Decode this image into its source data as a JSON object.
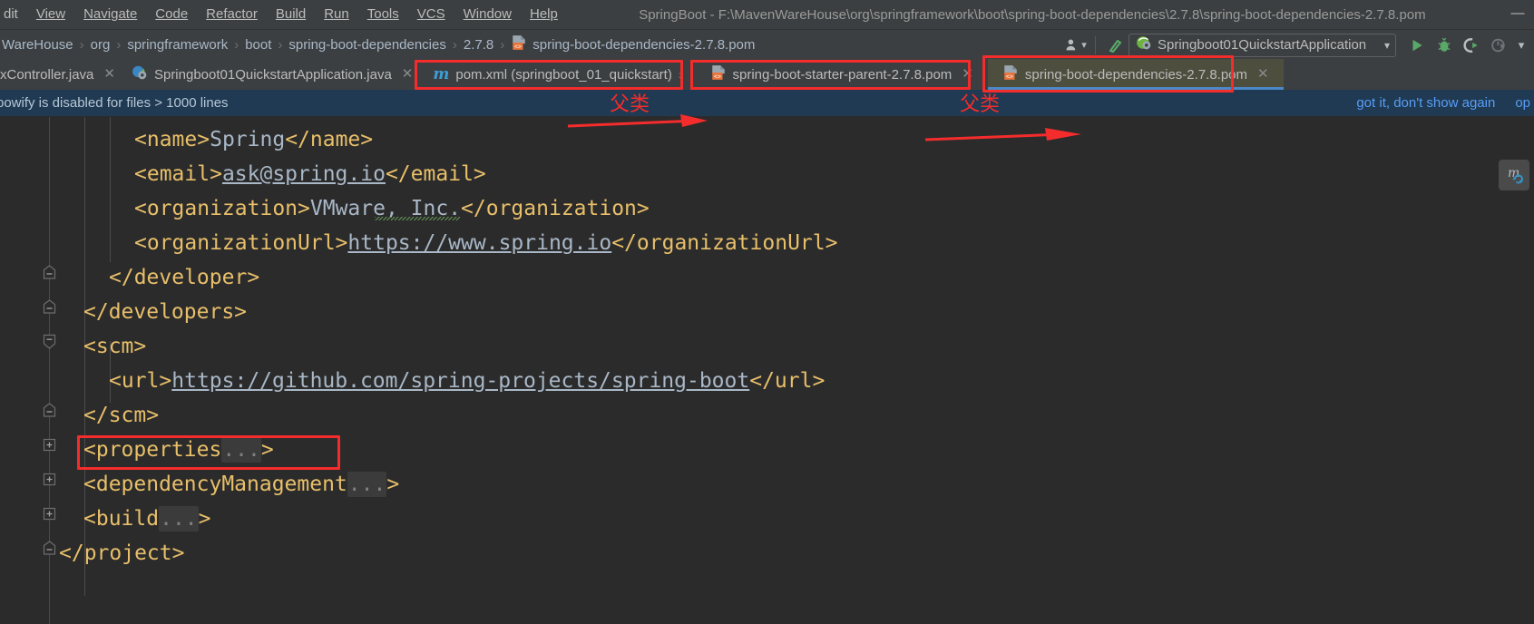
{
  "window": {
    "title": "SpringBoot - F:\\MavenWareHouse\\org\\springframework\\boot\\spring-boot-dependencies\\2.7.8\\spring-boot-dependencies-2.7.8.pom",
    "minimize_glyph": "—"
  },
  "menu": {
    "items": [
      {
        "label": "dit",
        "mnemonic": ""
      },
      {
        "label": "View",
        "mnemonic": "V"
      },
      {
        "label": "Navigate",
        "mnemonic": "N"
      },
      {
        "label": "Code",
        "mnemonic": "C"
      },
      {
        "label": "Refactor",
        "mnemonic": "R"
      },
      {
        "label": "Build",
        "mnemonic": "B"
      },
      {
        "label": "Run",
        "mnemonic": "u"
      },
      {
        "label": "Tools",
        "mnemonic": "T"
      },
      {
        "label": "VCS",
        "mnemonic": "S"
      },
      {
        "label": "Window",
        "mnemonic": "W"
      },
      {
        "label": "Help",
        "mnemonic": "H"
      }
    ]
  },
  "breadcrumb": {
    "items": [
      {
        "label": "WareHouse",
        "icon": ""
      },
      {
        "label": "org",
        "icon": ""
      },
      {
        "label": "springframework",
        "icon": ""
      },
      {
        "label": "boot",
        "icon": ""
      },
      {
        "label": "spring-boot-dependencies",
        "icon": ""
      },
      {
        "label": "2.7.8",
        "icon": ""
      },
      {
        "label": "spring-boot-dependencies-2.7.8.pom",
        "icon": "maven-pom-icon"
      }
    ],
    "separator": "›"
  },
  "toolbar": {
    "user_icon": "user-dropdown-icon",
    "build_icon": "build-hammer-icon",
    "run_config": {
      "icon": "spring-boot-run-icon",
      "label": "Springboot01QuickstartApplication",
      "chevron": "▾"
    },
    "run_icon": "run-play-icon",
    "debug_icon": "debug-bug-icon",
    "run_coverage_icon": "run-with-coverage-icon",
    "profiler_icon": "profiler-icon",
    "more_chevron": "▾"
  },
  "tabs": [
    {
      "label": "xController.java",
      "icon": "java-class-icon",
      "selected": false,
      "closable": true,
      "highlighted": false
    },
    {
      "label": "Springboot01QuickstartApplication.java",
      "icon": "spring-boot-class-icon",
      "selected": false,
      "closable": true,
      "highlighted": false
    },
    {
      "label": "pom.xml (springboot_01_quickstart)",
      "icon": "maven-m-icon",
      "selected": false,
      "closable": true,
      "highlighted": true
    },
    {
      "label": "spring-boot-starter-parent-2.7.8.pom",
      "icon": "maven-pom-icon",
      "selected": false,
      "closable": true,
      "highlighted": true
    },
    {
      "label": "spring-boot-dependencies-2.7.8.pom",
      "icon": "maven-pom-icon",
      "selected": true,
      "closable": true,
      "highlighted": true
    }
  ],
  "notification": {
    "message": "bowify is disabled for files > 1000 lines",
    "actions": [
      "got it, don't show again",
      "op"
    ]
  },
  "editor": {
    "maven_reload_icon": "maven-reload-icon",
    "lines": [
      {
        "indent": 4,
        "segments": [
          {
            "t": "tag",
            "v": "<name>"
          },
          {
            "t": "text",
            "v": "Spring"
          },
          {
            "t": "tag",
            "v": "</name>"
          }
        ],
        "fold": "none"
      },
      {
        "indent": 4,
        "segments": [
          {
            "t": "tag",
            "v": "<email>"
          },
          {
            "t": "link",
            "v": "ask@spring.io"
          },
          {
            "t": "tag",
            "v": "</email>"
          }
        ],
        "fold": "none"
      },
      {
        "indent": 4,
        "segments": [
          {
            "t": "tag",
            "v": "<organization>"
          },
          {
            "t": "text",
            "v": "VMware, Inc."
          },
          {
            "t": "tag",
            "v": "</organization>"
          }
        ],
        "fold": "none"
      },
      {
        "indent": 4,
        "segments": [
          {
            "t": "tag",
            "v": "<organizationUrl>"
          },
          {
            "t": "link",
            "v": "https://www.spring.io"
          },
          {
            "t": "tag",
            "v": "</organizationUrl>"
          }
        ],
        "fold": "none"
      },
      {
        "indent": 3,
        "segments": [
          {
            "t": "tag",
            "v": "</developer>"
          }
        ],
        "fold": "collapse"
      },
      {
        "indent": 2,
        "segments": [
          {
            "t": "tag",
            "v": "</developers>"
          }
        ],
        "fold": "collapse"
      },
      {
        "indent": 2,
        "segments": [
          {
            "t": "tag",
            "v": "<scm>"
          }
        ],
        "fold": "collapse-start"
      },
      {
        "indent": 3,
        "segments": [
          {
            "t": "tag",
            "v": "<url>"
          },
          {
            "t": "link",
            "v": "https://github.com/spring-projects/spring-boot"
          },
          {
            "t": "tag",
            "v": "</url>"
          }
        ],
        "fold": "none"
      },
      {
        "indent": 2,
        "segments": [
          {
            "t": "tag",
            "v": "</scm>"
          }
        ],
        "fold": "collapse"
      },
      {
        "indent": 2,
        "segments": [
          {
            "t": "tag",
            "v": "<properties"
          },
          {
            "t": "folded",
            "v": "..."
          },
          {
            "t": "tag",
            "v": ">"
          }
        ],
        "fold": "expand"
      },
      {
        "indent": 2,
        "segments": [
          {
            "t": "tag",
            "v": "<dependencyManagement"
          },
          {
            "t": "folded",
            "v": "..."
          },
          {
            "t": "tag",
            "v": ">"
          }
        ],
        "fold": "expand"
      },
      {
        "indent": 2,
        "segments": [
          {
            "t": "tag",
            "v": "<build"
          },
          {
            "t": "folded",
            "v": "..."
          },
          {
            "t": "tag",
            "v": ">"
          }
        ],
        "fold": "expand"
      },
      {
        "indent": 1,
        "segments": [
          {
            "t": "tag",
            "v": "</project>"
          }
        ],
        "fold": "collapse"
      }
    ]
  },
  "annotations": {
    "label_parent_class_1": "父类",
    "label_parent_class_2": "父类",
    "color": "#f42c2c"
  },
  "colors": {
    "chrome": "#3c3f41",
    "editor_bg": "#2b2b2b",
    "tab_selected_bg": "#4e4e3f",
    "tab_underline": "#4a88c7",
    "notification_bg": "#1f3a52",
    "link": "#589df6",
    "xml_tag": "#e8bf6a",
    "xml_text": "#a9b7c6",
    "annotation_red": "#f42c2c"
  }
}
